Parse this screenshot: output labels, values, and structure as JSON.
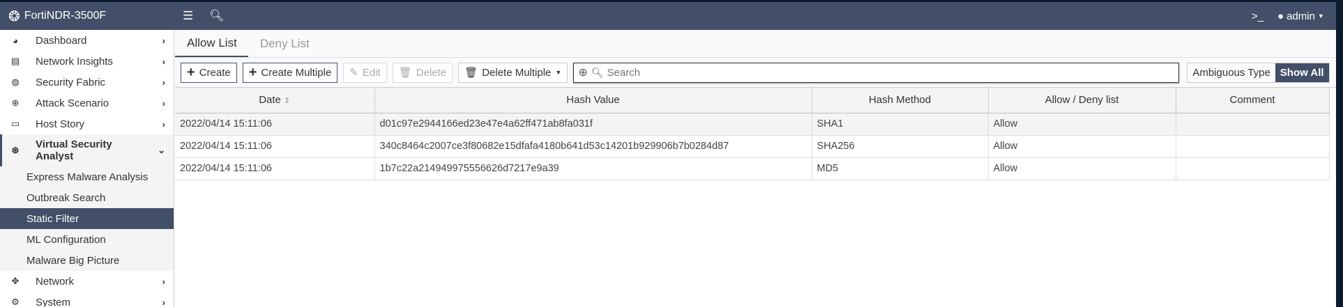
{
  "topbar": {
    "brand": "FortiNDR-3500F",
    "user": "admin"
  },
  "sidebar": {
    "items": [
      {
        "label": "Dashboard",
        "icon": "dashboard-icon"
      },
      {
        "label": "Network Insights",
        "icon": "network-insights-icon"
      },
      {
        "label": "Security Fabric",
        "icon": "security-fabric-icon"
      },
      {
        "label": "Attack Scenario",
        "icon": "crosshair-icon"
      },
      {
        "label": "Host Story",
        "icon": "monitor-icon"
      },
      {
        "label": "Virtual Security Analyst",
        "icon": "brain-icon"
      },
      {
        "label": "Network",
        "icon": "move-icon"
      },
      {
        "label": "System",
        "icon": "gear-icon"
      }
    ],
    "subitems": [
      "Express Malware Analysis",
      "Outbreak Search",
      "Static Filter",
      "ML Configuration",
      "Malware Big Picture"
    ]
  },
  "tabs": [
    "Allow List",
    "Deny List"
  ],
  "toolbar": {
    "create": "Create",
    "create_multiple": "Create Multiple",
    "edit": "Edit",
    "delete": "Delete",
    "delete_multiple": "Delete Multiple",
    "search_placeholder": "Search",
    "ambiguous": "Ambiguous Type",
    "show_all": "Show All"
  },
  "table": {
    "headers": [
      "Date",
      "Hash Value",
      "Hash Method",
      "Allow / Deny list",
      "Comment"
    ],
    "rows": [
      [
        "2022/04/14 15:11:06",
        "d01c97e2944166ed23e47e4a62ff471ab8fa031f",
        "SHA1",
        "Allow",
        ""
      ],
      [
        "2022/04/14 15:11:06",
        "340c8464c2007ce3f80682e15dfafa4180b641d53c14201b929906b7b0284d87",
        "SHA256",
        "Allow",
        ""
      ],
      [
        "2022/04/14 15:11:06",
        "1b7c22a214949975556626d7217e9a39",
        "MD5",
        "Allow",
        ""
      ]
    ]
  }
}
